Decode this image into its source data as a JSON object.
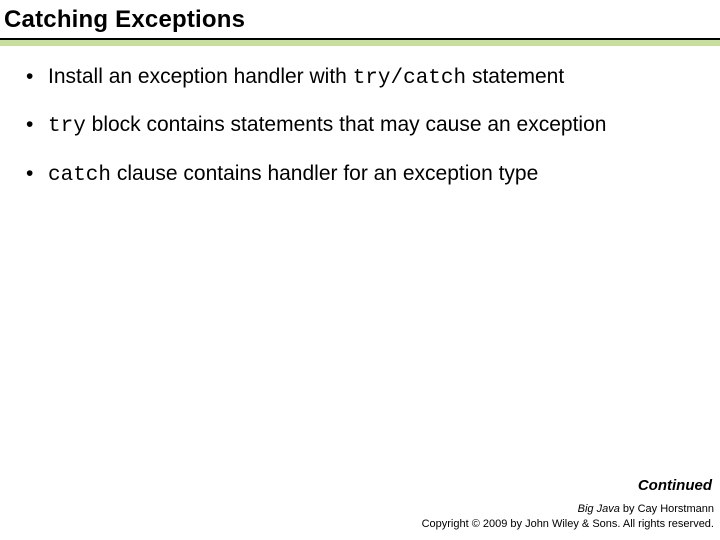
{
  "title": "Catching Exceptions",
  "bullets": {
    "b1_pre": "Install an exception handler with ",
    "b1_code": "try/catch",
    "b1_post": "  statement",
    "b2_code": "try",
    "b2_post": " block contains statements that may cause an exception",
    "b3_code": "catch",
    "b3_post": " clause contains handler for an exception type"
  },
  "continued": "Continued",
  "footer": {
    "book": "Big Java",
    "byline": " by Cay Horstmann",
    "copyright": "Copyright © 2009 by John Wiley & Sons. All rights reserved."
  }
}
